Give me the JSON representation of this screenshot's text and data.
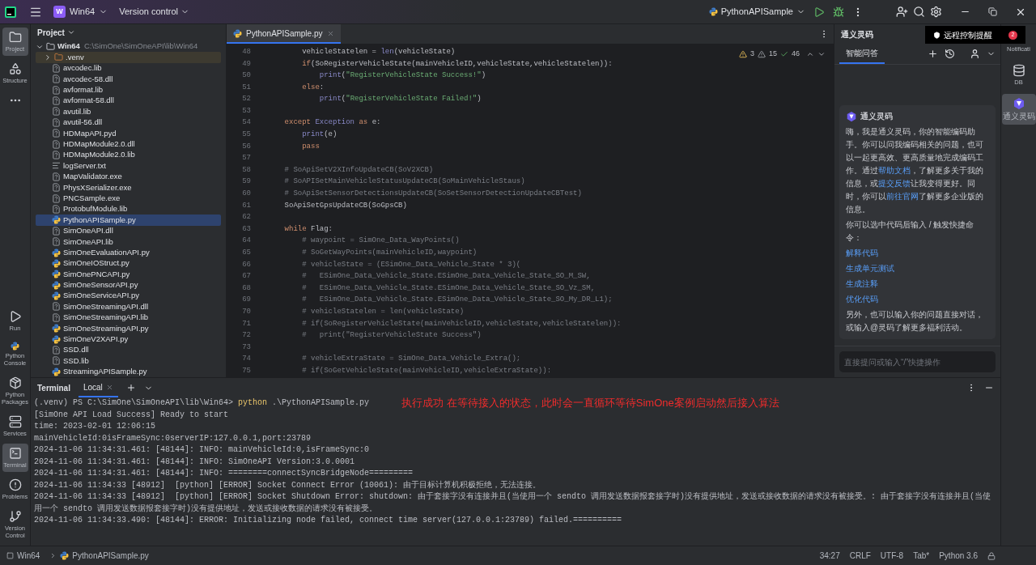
{
  "title_bar": {
    "project_badge": "W",
    "project": "Win64",
    "vcs": "Version control",
    "run_config": "PythonAPISample"
  },
  "left_toolbar": {
    "top": [
      {
        "kind": "project",
        "label": "Project",
        "selected": true
      },
      {
        "kind": "structure",
        "label": "Structure",
        "selected": false
      },
      {
        "kind": "more",
        "selected": false
      }
    ],
    "bottom": [
      {
        "kind": "run",
        "label": "Run",
        "selected": false
      },
      {
        "kind": "console",
        "label": "Python Console",
        "selected": false
      },
      {
        "kind": "packages",
        "label": "Python Packages",
        "selected": false
      },
      {
        "kind": "services",
        "label": "Services",
        "selected": false
      },
      {
        "kind": "terminal",
        "label": "Terminal",
        "selected": true
      },
      {
        "kind": "problems",
        "label": "Problems",
        "selected": false
      },
      {
        "kind": "vcs",
        "label": "Version Control",
        "selected": false
      }
    ]
  },
  "project_panel": {
    "title": "Project",
    "root": {
      "label": "Win64",
      "path": "C:\\SimOne\\SimOneAPI\\lib\\Win64",
      "expanded": true,
      "children": [
        {
          "label": ".venv",
          "kind": "excluded-folder",
          "expanded": false,
          "selected": false
        },
        {
          "label": "avcodec.lib",
          "kind": "unknown",
          "selected": false
        },
        {
          "label": "avcodec-58.dll",
          "kind": "unknown",
          "selected": false
        },
        {
          "label": "avformat.lib",
          "kind": "unknown",
          "selected": false
        },
        {
          "label": "avformat-58.dll",
          "kind": "unknown",
          "selected": false
        },
        {
          "label": "avutil.lib",
          "kind": "unknown",
          "selected": false
        },
        {
          "label": "avutil-56.dll",
          "kind": "unknown",
          "selected": false
        },
        {
          "label": "HDMapAPI.pyd",
          "kind": "unknown",
          "selected": false
        },
        {
          "label": "HDMapModule2.0.dll",
          "kind": "unknown",
          "selected": false
        },
        {
          "label": "HDMapModule2.0.lib",
          "kind": "unknown",
          "selected": false
        },
        {
          "label": "logServer.txt",
          "kind": "text",
          "selected": false
        },
        {
          "label": "MapValidator.exe",
          "kind": "unknown",
          "selected": false
        },
        {
          "label": "PhysXSerializer.exe",
          "kind": "unknown",
          "selected": false
        },
        {
          "label": "PNCSample.exe",
          "kind": "unknown",
          "selected": false
        },
        {
          "label": "ProtobufModule.lib",
          "kind": "unknown",
          "selected": false
        },
        {
          "label": "PythonAPISample.py",
          "kind": "python",
          "selected": true
        },
        {
          "label": "SimOneAPI.dll",
          "kind": "unknown",
          "selected": false
        },
        {
          "label": "SimOneAPI.lib",
          "kind": "unknown",
          "selected": false
        },
        {
          "label": "SimOneEvaluationAPI.py",
          "kind": "python",
          "selected": false
        },
        {
          "label": "SimOneIOStruct.py",
          "kind": "python",
          "selected": false
        },
        {
          "label": "SimOnePNCAPI.py",
          "kind": "python",
          "selected": false
        },
        {
          "label": "SimOneSensorAPI.py",
          "kind": "python",
          "selected": false
        },
        {
          "label": "SimOneServiceAPI.py",
          "kind": "python",
          "selected": false
        },
        {
          "label": "SimOneStreamingAPI.dll",
          "kind": "unknown",
          "selected": false
        },
        {
          "label": "SimOneStreamingAPI.lib",
          "kind": "unknown",
          "selected": false
        },
        {
          "label": "SimOneStreamingAPI.py",
          "kind": "python",
          "selected": false
        },
        {
          "label": "SimOneV2XAPI.py",
          "kind": "python",
          "selected": false
        },
        {
          "label": "SSD.dll",
          "kind": "unknown",
          "selected": false
        },
        {
          "label": "SSD.lib",
          "kind": "unknown",
          "selected": false
        },
        {
          "label": "StreamingAPISample.py",
          "kind": "python",
          "selected": false
        }
      ]
    }
  },
  "editor": {
    "tabs": [
      {
        "label": "PythonAPISample.py",
        "selected": true
      }
    ],
    "inspections": {
      "errors": "3",
      "warnings": "15",
      "typos": "46"
    },
    "lines": [
      {
        "num": "48",
        "segments": [
          {
            "text": "        vehicleStatelen = ",
            "kind": "t"
          },
          {
            "text": "len",
            "kind": "bi"
          },
          {
            "text": "(vehicleState)",
            "kind": "t"
          }
        ]
      },
      {
        "num": "49",
        "segments": [
          {
            "text": "        if",
            "kind": "kw"
          },
          {
            "text": "(SoRegisterVehicleState(mainVehicleID,vehicleState,vehicleStatelen)):",
            "kind": "t"
          }
        ]
      },
      {
        "num": "50",
        "segments": [
          {
            "text": "            print",
            "kind": "bi"
          },
          {
            "text": "(",
            "kind": "t"
          },
          {
            "text": "\"RegisterVehicleState Success!\"",
            "kind": "str"
          },
          {
            "text": ")",
            "kind": "t"
          }
        ]
      },
      {
        "num": "51",
        "segments": [
          {
            "text": "        else",
            "kind": "kw"
          },
          {
            "text": ":",
            "kind": "t"
          }
        ]
      },
      {
        "num": "52",
        "segments": [
          {
            "text": "            print",
            "kind": "bi"
          },
          {
            "text": "(",
            "kind": "t"
          },
          {
            "text": "\"RegisterVehicleState Failed!\"",
            "kind": "str"
          },
          {
            "text": ")",
            "kind": "t"
          }
        ]
      },
      {
        "num": "53"
      },
      {
        "num": "54",
        "segments": [
          {
            "text": "    except",
            "kind": "kw"
          },
          {
            "text": " Exception ",
            "kind": "bi"
          },
          {
            "text": "as",
            "kind": "kw"
          },
          {
            "text": " e:",
            "kind": "t"
          }
        ]
      },
      {
        "num": "55",
        "segments": [
          {
            "text": "        print",
            "kind": "bi"
          },
          {
            "text": "(e)",
            "kind": "t"
          }
        ]
      },
      {
        "num": "56",
        "segments": [
          {
            "text": "        pass",
            "kind": "kw"
          }
        ]
      },
      {
        "num": "57"
      },
      {
        "num": "58",
        "segments": [
          {
            "text": "    # SoApiSetV2XInfoUpdateCB(SoV2XCB)",
            "kind": "cm"
          }
        ]
      },
      {
        "num": "59",
        "segments": [
          {
            "text": "    # SoAPISetMainVehicleStatusUpdateCB(SoMainVehicleStaus)",
            "kind": "cm"
          }
        ]
      },
      {
        "num": "60",
        "segments": [
          {
            "text": "    # SoApiSetSensorDetectionsUpdateCB(SoSetSensorDetectionUpdateCBTest)",
            "kind": "cm"
          }
        ]
      },
      {
        "num": "61",
        "segments": [
          {
            "text": "    SoApiSetGpsUpdateCB(SoGpsCB)",
            "kind": "t"
          }
        ]
      },
      {
        "num": "62"
      },
      {
        "num": "63",
        "segments": [
          {
            "text": "    while",
            "kind": "kw"
          },
          {
            "text": " Flag:",
            "kind": "t"
          }
        ]
      },
      {
        "num": "64",
        "segments": [
          {
            "text": "        # waypoint = SimOne_Data_WayPoints()",
            "kind": "cm"
          }
        ]
      },
      {
        "num": "65",
        "segments": [
          {
            "text": "        # SoGetWayPoints(mainVehicleID,waypoint)",
            "kind": "cm"
          }
        ]
      },
      {
        "num": "66",
        "segments": [
          {
            "text": "        # vehicleState = (ESimOne_Data_Vehicle_State * 3)(",
            "kind": "cm"
          }
        ]
      },
      {
        "num": "67",
        "segments": [
          {
            "text": "        #   ESimOne_Data_Vehicle_State.ESimOne_Data_Vehicle_State_SO_M_SW,",
            "kind": "cm"
          }
        ]
      },
      {
        "num": "68",
        "segments": [
          {
            "text": "        #   ESimOne_Data_Vehicle_State.ESimOne_Data_Vehicle_State_SO_Vz_SM,",
            "kind": "cm"
          }
        ]
      },
      {
        "num": "69",
        "segments": [
          {
            "text": "        #   ESimOne_Data_Vehicle_State.ESimOne_Data_Vehicle_State_SO_My_DR_L1);",
            "kind": "cm"
          }
        ]
      },
      {
        "num": "70",
        "segments": [
          {
            "text": "        # vehicleStatelen = len(vehicleState)",
            "kind": "cm"
          }
        ]
      },
      {
        "num": "71",
        "segments": [
          {
            "text": "        # if(SoRegisterVehicleState(mainVehicleID,vehicleState,vehicleStatelen)):",
            "kind": "cm"
          }
        ]
      },
      {
        "num": "72",
        "segments": [
          {
            "text": "        #   print(\"RegisterVehicleState Success\")",
            "kind": "cm"
          }
        ]
      },
      {
        "num": "73"
      },
      {
        "num": "74",
        "segments": [
          {
            "text": "        # vehicleExtraState = SimOne_Data_Vehicle_Extra();",
            "kind": "cm"
          }
        ]
      },
      {
        "num": "75",
        "segments": [
          {
            "text": "        # if(SoGetVehicleState(mainVehicleID,vehicleExtraState)):",
            "kind": "cm"
          }
        ]
      }
    ]
  },
  "assistant_panel": {
    "title": "通义灵码",
    "tabs": [
      {
        "label": "智能问答",
        "selected": true
      }
    ],
    "card": {
      "title": "通义灵码",
      "intro": [
        {
          "text": "嗨，我是通义灵码，你的智能编码助手。你可以问我编码相关的问题，也可以一起更高效、更高质量地完成编码工作。通过",
          "kind": "text"
        },
        {
          "text": "帮助文档",
          "kind": "link"
        },
        {
          "text": "，了解更多关于我的信息，或",
          "kind": "text"
        },
        {
          "text": "提交反馈",
          "kind": "link"
        },
        {
          "text": "让我变得更好。同时，你可以",
          "kind": "text"
        },
        {
          "text": "前往官网",
          "kind": "link"
        },
        {
          "text": "了解更多企业版的信息。",
          "kind": "text"
        }
      ],
      "commands_hint": "你可以选中代码后输入 / 触发快捷命令：",
      "commands": [
        "解释代码",
        "生成单元测试",
        "生成注释",
        "优化代码"
      ],
      "footer": "另外，也可以输入你的问题直接对话，或输入@灵码了解更多福利活动。"
    },
    "input": {
      "placeholder": "直接提问或输入“/”快捷操作"
    }
  },
  "right_toolbar": [
    {
      "kind": "notifications",
      "label": "Notificati",
      "selected": false
    },
    {
      "kind": "db",
      "label": "DB",
      "selected": false
    },
    {
      "kind": "lingma",
      "label": "通义灵码",
      "selected": true
    }
  ],
  "notification_popup": {
    "text": "远程控制提醒",
    "count": "2"
  },
  "terminal": {
    "title": "Terminal",
    "tabs": [
      {
        "label": "Local",
        "selected": true
      }
    ],
    "prompt": "(.venv) PS C:\\SimOne\\SimOneAPI\\lib\\Win64>",
    "program": "python",
    "args": ".\\PythonAPISample.py",
    "annotation": "执行成功 在等待接入的状态，此时会一直循环等待SimOne案例启动然后接入算法",
    "output": [
      "[SimOne API Load Success] Ready to start",
      "time: 2023-02-01 12:06:15",
      "mainVehicleId:0isFrameSync:0serverIP:127.0.0.1,port:23789",
      "2024-11-06 11:34:31.461: [48144]: INFO: mainVehicleId:0,isFrameSync:0",
      "2024-11-06 11:34:31.461: [48144]: INFO: SimOneAPI Version:3.0.0001",
      "2024-11-06 11:34:31.461: [48144]: INFO: ========connectSyncBridgeNode=========",
      "2024-11-06 11:34:33 [48912]  [python] [ERROR] Socket Connect Error (10061): 由于目标计算机积极拒绝，无法连接。",
      "2024-11-06 11:34:33 [48912]  [python] [ERROR] Socket Shutdown Error: shutdown: 由于套接字没有连接并且(当使用一个 sendto 调用发送数据报套接字时)没有提供地址，发送或接收数据的请求没有被接受。: 由于套接字没有连接并且(当使用一个 sendto 调用发送数据报套接字时)没有提供地址，发送或接收数据的请求没有被接受。",
      "2024-11-06 11:34:33.490: [48144]: ERROR: Initializing node failed, connect time server(127.0.0.1:23789) failed.=========="
    ]
  },
  "status_bar": {
    "breadcrumbs": [
      "Win64",
      "PythonAPISample.py"
    ],
    "position": "34:27",
    "line_separator": "CRLF",
    "encoding": "UTF-8",
    "indent": "Tab*",
    "interpreter": "Python 3.6"
  }
}
